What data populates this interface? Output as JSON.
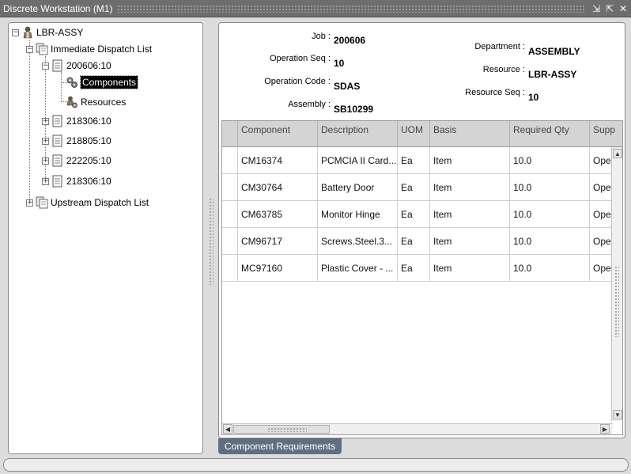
{
  "window": {
    "title": "Discrete Workstation (M1)",
    "minimize_glyph": "⇲",
    "maximize_glyph": "⇱",
    "close_glyph": "✕"
  },
  "tree": {
    "root_label": "LBR-ASSY",
    "immediate_label": "Immediate Dispatch List",
    "job_selected_label": "200606:10",
    "components_label": "Components",
    "resources_label": "Resources",
    "jobs": [
      {
        "label": "218306:10"
      },
      {
        "label": "218805:10"
      },
      {
        "label": "222205:10"
      },
      {
        "label": "218306:10"
      }
    ],
    "upstream_label": "Upstream Dispatch List",
    "expanded_glyph": "−",
    "collapsed_glyph": "+"
  },
  "details": {
    "job_label": "Job :",
    "job_value": "200606",
    "opseq_label": "Operation Seq :",
    "opseq_value": "10",
    "opcode_label": "Operation Code :",
    "opcode_value": "SDAS",
    "assembly_label": "Assembly :",
    "assembly_value": "SB10299",
    "dept_label": "Department :",
    "dept_value": "ASSEMBLY",
    "resource_label": "Resource :",
    "resource_value": "LBR-ASSY",
    "resseq_label": "Resource Seq :",
    "resseq_value": "10"
  },
  "table": {
    "headers": {
      "component": "Component",
      "description": "Description",
      "uom": "UOM",
      "basis": "Basis",
      "required_qty": "Required Qty",
      "supply": "Supp"
    },
    "rows": [
      {
        "component": "CM16374",
        "description": "PCMCIA II Card...",
        "uom": "Ea",
        "basis": "Item",
        "required_qty": "10.0",
        "supply": "Ope"
      },
      {
        "component": "CM30764",
        "description": "Battery Door",
        "uom": "Ea",
        "basis": "Item",
        "required_qty": "10.0",
        "supply": "Ope"
      },
      {
        "component": "CM63785",
        "description": "Monitor Hinge",
        "uom": "Ea",
        "basis": "Item",
        "required_qty": "10.0",
        "supply": "Ope"
      },
      {
        "component": "CM96717",
        "description": "Screws.Steel.3...",
        "uom": "Ea",
        "basis": "Item",
        "required_qty": "10.0",
        "supply": "Ope"
      },
      {
        "component": "MC97160",
        "description": "Plastic Cover - ...",
        "uom": "Ea",
        "basis": "Item",
        "required_qty": "10.0",
        "supply": "Ope"
      }
    ],
    "scroll_up_glyph": "▲",
    "scroll_down_glyph": "▼",
    "scroll_left_glyph": "◀",
    "scroll_right_glyph": "▶"
  },
  "tabs": {
    "component_requirements": "Component Requirements"
  }
}
